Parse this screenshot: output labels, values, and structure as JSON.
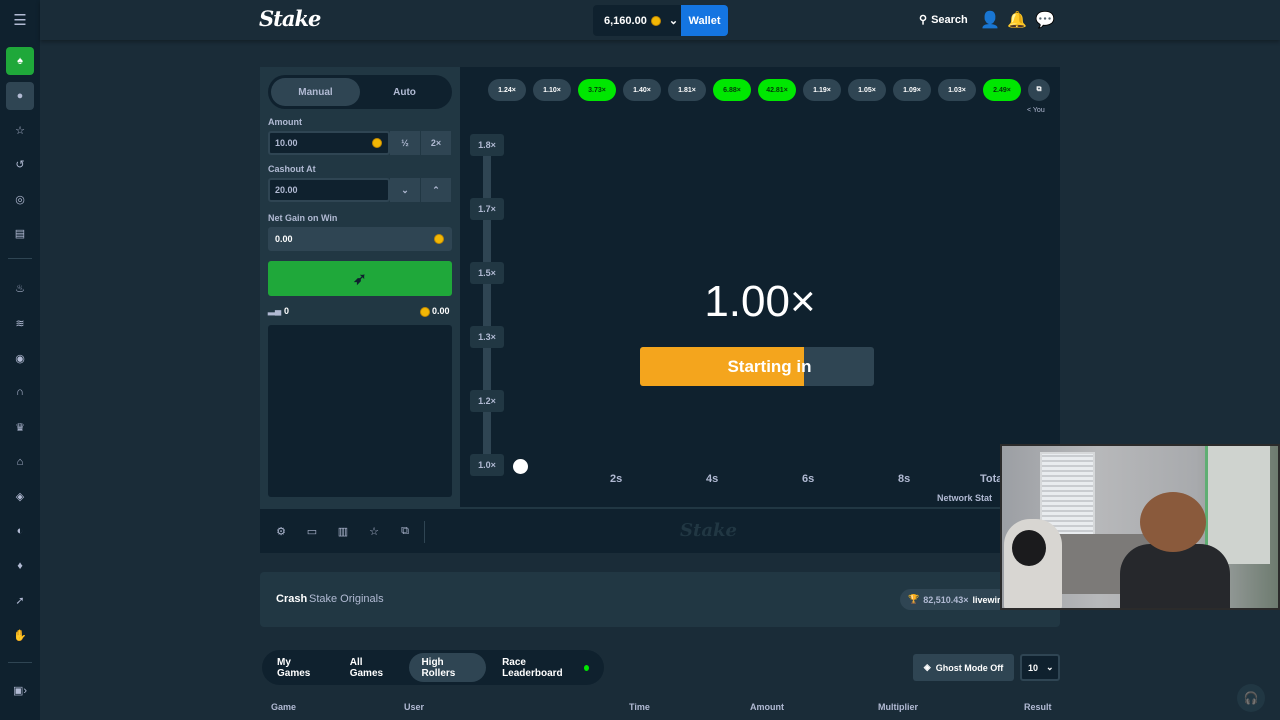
{
  "header": {
    "logo": "Stake",
    "balance": "6,160.00",
    "wallet_label": "Wallet",
    "search_label": "Search"
  },
  "controls": {
    "tabs": [
      "Manual",
      "Auto"
    ],
    "amount_label": "Amount",
    "amount_value": "10.00",
    "half_label": "½",
    "double_label": "2×",
    "cashout_label": "Cashout At",
    "cashout_value": "20.00",
    "netgain_label": "Net Gain on Win",
    "netgain_value": "0.00",
    "players_count": "0",
    "total_bet": "0.00"
  },
  "history": [
    "1.24×",
    "1.10×",
    "3.73×",
    "1.40×",
    "1.81×",
    "6.88×",
    "42.81×",
    "1.19×",
    "1.05×",
    "1.09×",
    "1.03×",
    "2.49×"
  ],
  "history_wins": [
    false,
    false,
    true,
    false,
    false,
    true,
    true,
    false,
    false,
    false,
    false,
    true
  ],
  "you_label": "< You",
  "graph": {
    "y_ticks": [
      "1.8×",
      "1.7×",
      "1.5×",
      "1.3×",
      "1.2×",
      "1.0×"
    ],
    "x_ticks": [
      "2s",
      "4s",
      "6s",
      "8s",
      "Tota"
    ],
    "network_status": "Network Stat",
    "multiplier": "1.00×",
    "status_text": "Starting in",
    "progress_fraction": 0.7
  },
  "footer_logo": "Stake",
  "info": {
    "game": "Crash",
    "provider": "Stake Originals",
    "top_win": "82,510.43×",
    "top_user": "livewire"
  },
  "bets_tabs": [
    "My Games",
    "All Games",
    "High Rollers",
    "Race Leaderboard"
  ],
  "ghost_label": "Ghost Mode Off",
  "rows_value": "10",
  "table_headers": [
    "Game",
    "User",
    "Time",
    "Amount",
    "Multiplier",
    "Result"
  ],
  "colors": {
    "win": "#00e701",
    "bet_button": "#1fa83a",
    "wallet": "#1475e1",
    "progress": "#f4a51d"
  }
}
